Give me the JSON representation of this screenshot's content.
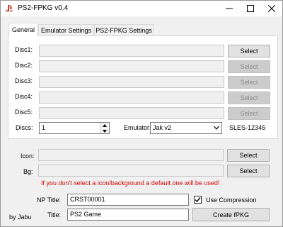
{
  "window": {
    "title": "PS2-FPKG v0.4"
  },
  "tabs": [
    {
      "label": "General"
    },
    {
      "label": "Emulator Settings"
    },
    {
      "label": "PS2-FPKG Settings"
    }
  ],
  "discs": [
    {
      "label": "Disc1:",
      "value": "",
      "button": "Select"
    },
    {
      "label": "Disc2:",
      "value": "",
      "button": "Select"
    },
    {
      "label": "Disc3:",
      "value": "",
      "button": "Select"
    },
    {
      "label": "Disc4:",
      "value": "",
      "button": "Select"
    },
    {
      "label": "Disc5:",
      "value": "",
      "button": "Select"
    }
  ],
  "discs_count": {
    "label": "Discs:",
    "value": "1"
  },
  "emulator": {
    "label": "Emulator:",
    "value": "Jak v2"
  },
  "game_id": "SLES-12345",
  "icon": {
    "label": "Icon:",
    "value": "",
    "button": "Select"
  },
  "bg": {
    "label": "Bg:",
    "value": "",
    "button": "Select"
  },
  "hint": "If you don't select a icon/background a default one will be used!",
  "np_title": {
    "label": "NP Title:",
    "value": "CRST00001"
  },
  "use_compression": {
    "label": "Use Compression",
    "checked": true
  },
  "title": {
    "label": "Title:",
    "value": "PS2 Game"
  },
  "create_button": "Create fPKG",
  "credit": "by Jabu",
  "colors": {
    "hint_red": "#d00000",
    "window_bg": "#f0f0f0",
    "ps_logo_red": "#c0392b"
  }
}
